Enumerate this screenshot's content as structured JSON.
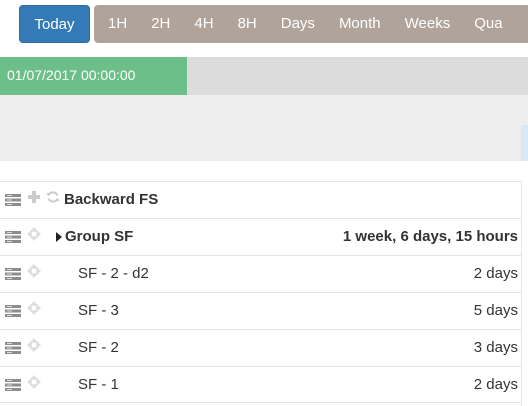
{
  "toolbar": {
    "today_label": "Today",
    "zoom_options": [
      "1H",
      "2H",
      "4H",
      "8H",
      "Days",
      "Month",
      "Weeks",
      "Qua"
    ]
  },
  "timeline": {
    "current_date": "01/07/2017 00:00:00"
  },
  "rows": [
    {
      "name": "Backward FS",
      "duration": "",
      "kind": "project"
    },
    {
      "name": "Group SF",
      "duration": "1 week, 6 days, 15 hours",
      "kind": "group"
    },
    {
      "name": "SF - 2 - d2",
      "duration": "2 days",
      "kind": "task"
    },
    {
      "name": "SF - 3",
      "duration": "5 days",
      "kind": "task"
    },
    {
      "name": "SF - 2",
      "duration": "3 days",
      "kind": "task"
    },
    {
      "name": "SF - 1",
      "duration": "2 days",
      "kind": "task"
    }
  ],
  "colors": {
    "today_button": "#337ab7",
    "zoom_group": "#b0a49a",
    "date_badge": "#6dbf89"
  },
  "icons": {
    "row_handle": "drag-handle-icon",
    "add": "plus-icon",
    "refresh": "sync-icon",
    "move": "move-icon",
    "expand": "caret-right-icon"
  }
}
